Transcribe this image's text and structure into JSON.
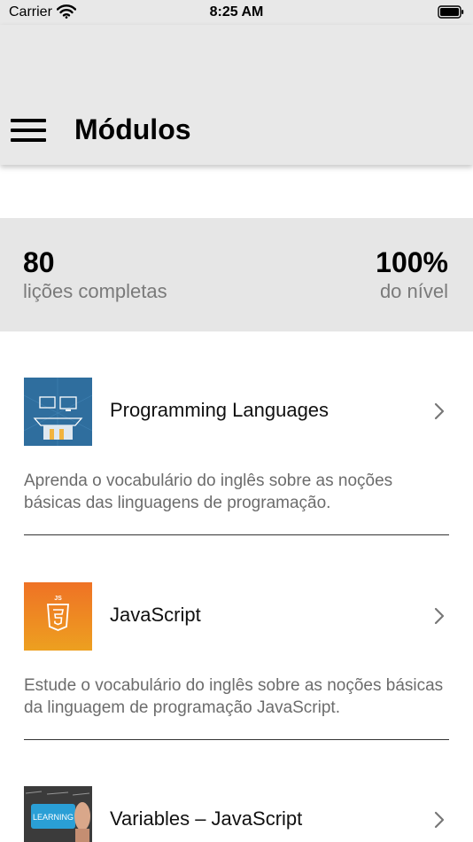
{
  "status_bar": {
    "carrier": "Carrier",
    "time": "8:25 AM",
    "icons": [
      "wifi-icon",
      "battery-icon"
    ]
  },
  "navbar": {
    "title": "Módulos",
    "menu_icon": "hamburger-menu-icon",
    "background": "#e8e8e8"
  },
  "stats": {
    "lessons_value": "80",
    "lessons_label": "lições completas",
    "level_value": "100%",
    "level_label": "do nível",
    "background": "#e6e6e6"
  },
  "modules": [
    {
      "title": "Programming Languages",
      "description": "Aprenda o vocabulário do inglês sobre as noções básicas das linguagens de programação.",
      "thumbnail_icon": "programming-languages-thumbnail",
      "thumbnail_color": "#2f6e9e"
    },
    {
      "title": "JavaScript",
      "description": "Estude o vocabulário do inglês sobre as noções básicas da linguagem de programação JavaScript.",
      "thumbnail_icon": "javascript-thumbnail",
      "thumbnail_color": "#ee7b22",
      "thumbnail_text": "JS"
    },
    {
      "title": "Variables – JavaScript",
      "description": "",
      "thumbnail_icon": "variables-thumbnail",
      "thumbnail_color": "#2a9fd6",
      "thumbnail_text": "LEARNING"
    }
  ],
  "chevron_icon": "chevron-right-icon"
}
